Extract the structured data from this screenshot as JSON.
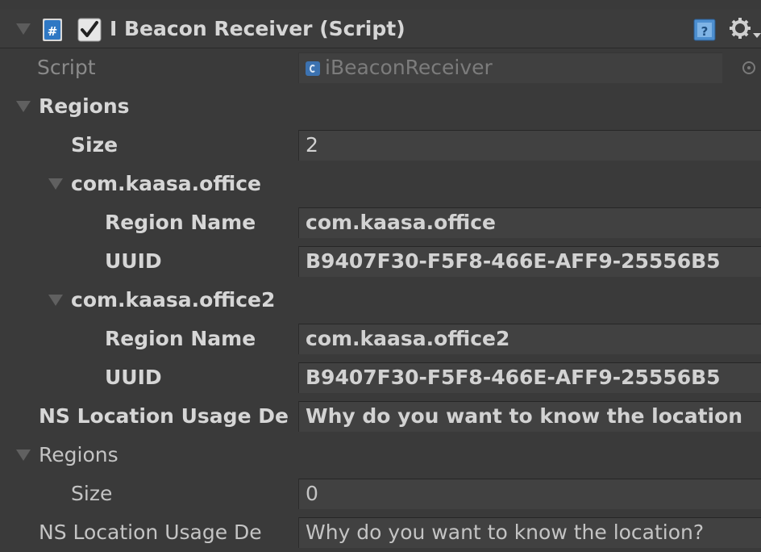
{
  "component": {
    "title": "I Beacon Receiver (Script)",
    "enabled": true,
    "script_label": "Script",
    "script_value": "iBeaconReceiver"
  },
  "regions_a": {
    "label": "Regions",
    "size_label": "Size",
    "size_value": "2",
    "items": [
      {
        "header": "com.kaasa.office",
        "region_name_label": "Region Name",
        "region_name_value": "com.kaasa.office",
        "uuid_label": "UUID",
        "uuid_value": "B9407F30-F5F8-466E-AFF9-25556B5"
      },
      {
        "header": "com.kaasa.office2",
        "region_name_label": "Region Name",
        "region_name_value": "com.kaasa.office2",
        "uuid_label": "UUID",
        "uuid_value": "B9407F30-F5F8-466E-AFF9-25556B5"
      }
    ],
    "ns_label": "NS Location Usage De",
    "ns_value": "Why do you want to know the location"
  },
  "regions_b": {
    "label": "Regions",
    "size_label": "Size",
    "size_value": "0",
    "ns_label": "NS Location Usage De",
    "ns_value": "Why do you want to know the location?"
  }
}
